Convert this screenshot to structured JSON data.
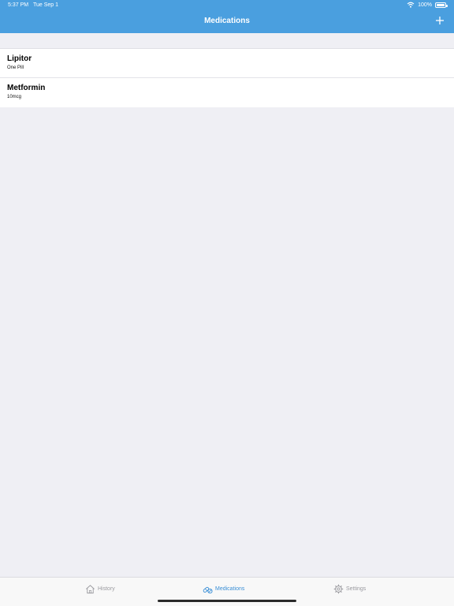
{
  "status_bar": {
    "time": "5:37 PM",
    "date": "Tue Sep 1",
    "battery": "100%"
  },
  "nav": {
    "title": "Medications",
    "add_icon": "plus-icon"
  },
  "medications": [
    {
      "name": "Lipitor",
      "dose": "One Pill"
    },
    {
      "name": "Metformin",
      "dose": "10mcg"
    }
  ],
  "tabs": [
    {
      "label": "History",
      "icon": "house-icon",
      "active": false
    },
    {
      "label": "Medications",
      "icon": "pills-icon",
      "active": true
    },
    {
      "label": "Settings",
      "icon": "gear-icon",
      "active": false
    }
  ],
  "colors": {
    "header": "#4a9fdf",
    "background": "#efeff4",
    "tab_active": "#3a8fd6",
    "tab_inactive": "#9a9a9f"
  }
}
